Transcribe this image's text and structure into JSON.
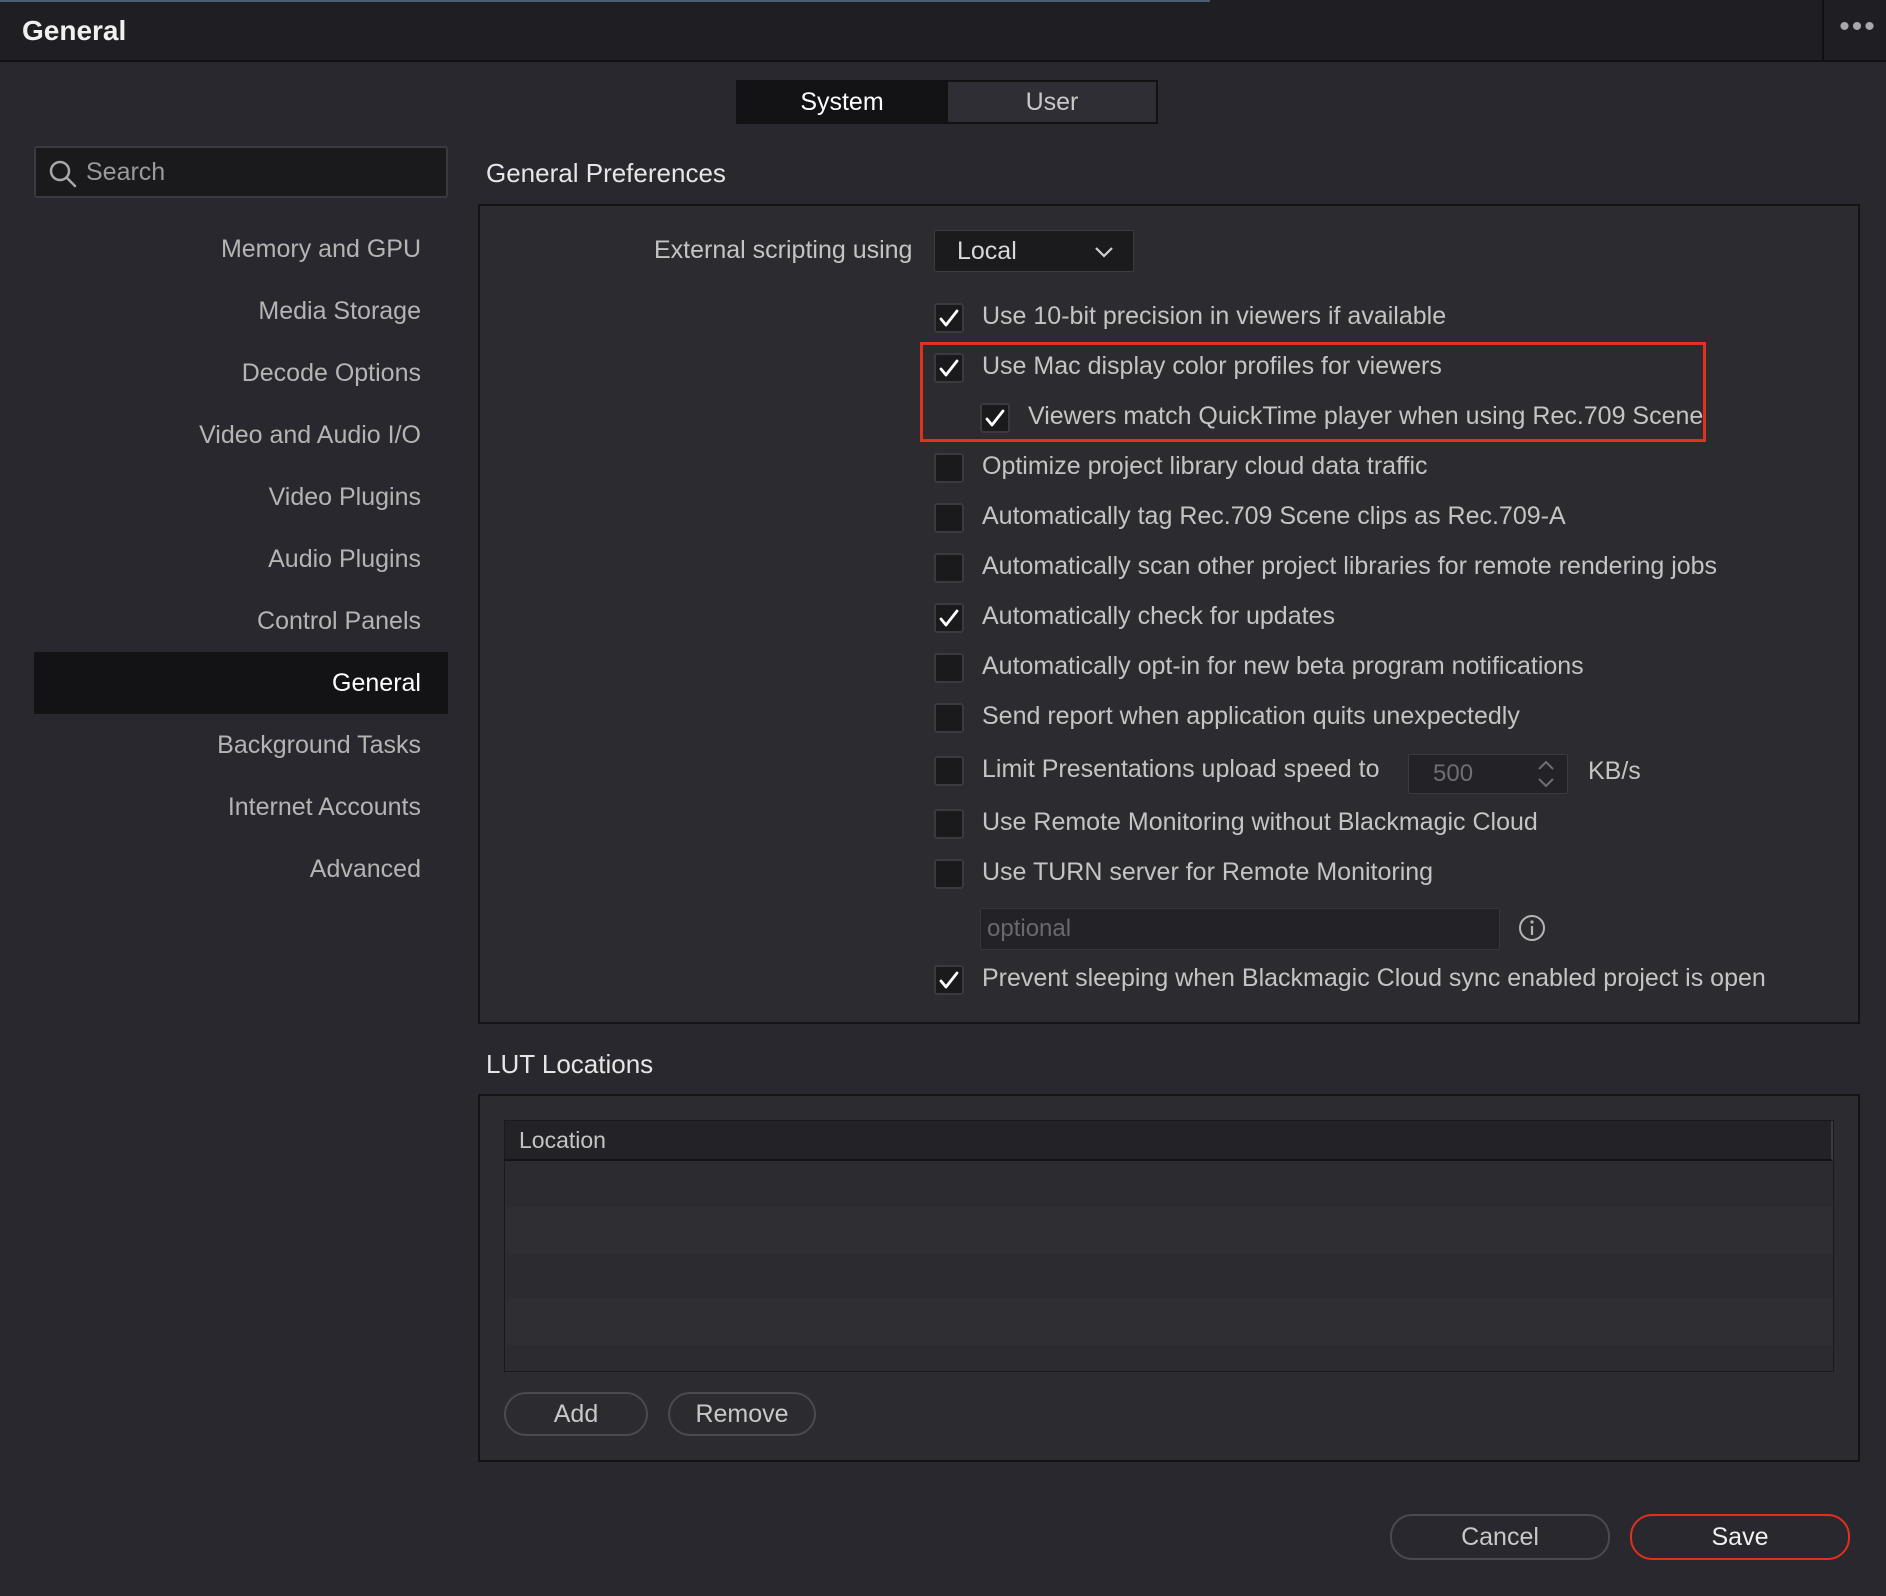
{
  "window": {
    "title": "General",
    "more_label": "•••"
  },
  "tabs": [
    {
      "label": "System",
      "active": true
    },
    {
      "label": "User",
      "active": false
    }
  ],
  "search": {
    "placeholder": "Search"
  },
  "sidebar": {
    "items": [
      {
        "label": "Memory and GPU"
      },
      {
        "label": "Media Storage"
      },
      {
        "label": "Decode Options"
      },
      {
        "label": "Video and Audio I/O"
      },
      {
        "label": "Video Plugins"
      },
      {
        "label": "Audio Plugins"
      },
      {
        "label": "Control Panels"
      },
      {
        "label": "General",
        "active": true
      },
      {
        "label": "Background Tasks"
      },
      {
        "label": "Internet Accounts"
      },
      {
        "label": "Advanced"
      }
    ]
  },
  "general_preferences": {
    "title": "General Preferences",
    "scripting": {
      "label": "External scripting using",
      "value": "Local"
    },
    "options": [
      {
        "label": "Use 10-bit precision in viewers if available",
        "checked": true
      },
      {
        "label": "Use Mac display color profiles for viewers",
        "checked": true
      },
      {
        "label": "Viewers match QuickTime player when using Rec.709 Scene",
        "checked": true
      },
      {
        "label": "Optimize project library cloud data traffic",
        "checked": false
      },
      {
        "label": "Automatically tag Rec.709 Scene clips as Rec.709-A",
        "checked": false
      },
      {
        "label": "Automatically scan other project libraries for remote rendering jobs",
        "checked": false
      },
      {
        "label": "Automatically check for updates",
        "checked": true
      },
      {
        "label": "Automatically opt-in for new beta program notifications",
        "checked": false
      },
      {
        "label": "Send report when application quits unexpectedly",
        "checked": false
      },
      {
        "label": "Limit Presentations upload speed to",
        "checked": false
      },
      {
        "label": "Use Remote Monitoring without Blackmagic Cloud",
        "checked": false
      },
      {
        "label": "Use TURN server for Remote Monitoring",
        "checked": false
      },
      {
        "label": "Prevent sleeping when Blackmagic Cloud sync enabled project is open",
        "checked": true
      }
    ],
    "upload_speed": {
      "value": "500",
      "unit": "KB/s"
    },
    "turn_server": {
      "value": "",
      "placeholder": "optional"
    },
    "highlight_color": "#e1301e"
  },
  "lut_locations": {
    "title": "LUT Locations",
    "column_header": "Location",
    "rows": [],
    "add_label": "Add",
    "remove_label": "Remove"
  },
  "footer": {
    "cancel_label": "Cancel",
    "save_label": "Save"
  }
}
